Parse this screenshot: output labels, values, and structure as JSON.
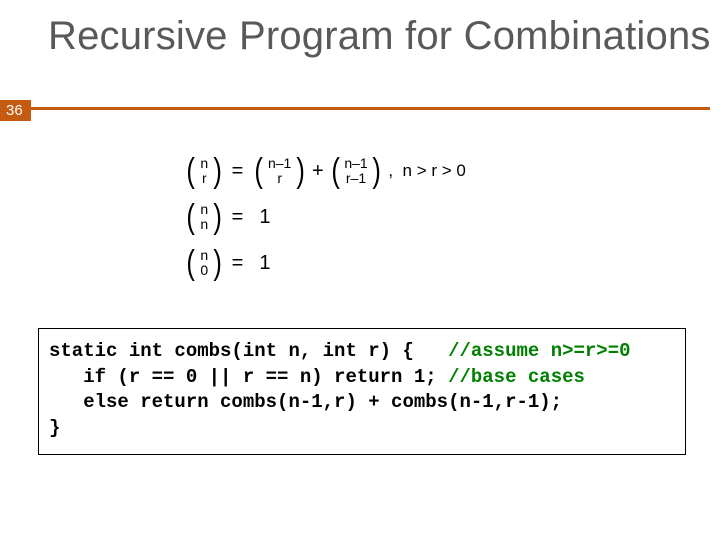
{
  "page_number": "36",
  "title": "Recursive Program for Combinations",
  "equations": {
    "line1": {
      "b1_top": "n",
      "b1_bot": "r",
      "eq": "=",
      "b2_top": "n–1",
      "b2_bot": "r",
      "plus": "+",
      "b3_top": "n–1",
      "b3_bot": "r–1",
      "trail": ",  n > r > 0"
    },
    "line2": {
      "b_top": "n",
      "b_bot": "n",
      "eq": "=",
      "rhs": "1"
    },
    "line3": {
      "b_top": "n",
      "b_bot": "0",
      "eq": "=",
      "rhs": "1"
    }
  },
  "code": {
    "l1a": "static int combs(int n, int r) {   ",
    "l1c": "//assume n>=r>=0",
    "l2a": "   if (r == 0 || r == n) return 1; ",
    "l2c": "//base cases",
    "l3": "   else return combs(n-1,r) + combs(n-1,r-1);",
    "l4": "}"
  }
}
